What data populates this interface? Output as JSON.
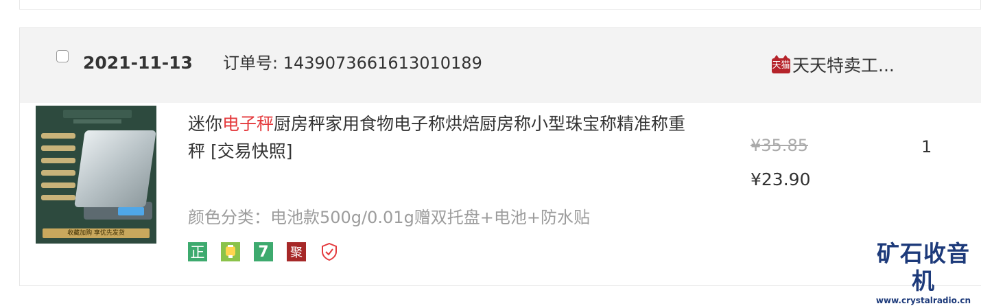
{
  "order": {
    "date": "2021-11-13",
    "order_number_label": "订单号: 1439073661613010189",
    "shop": {
      "icon_name": "tmall-icon",
      "icon_text": "天猫",
      "name": "天天特卖工..."
    }
  },
  "item": {
    "title_prefix": "迷你",
    "title_highlight": "电子秤",
    "title_suffix": "厨房秤家用食物电子称烘焙厨房称小型珠宝称精准称重秤 [交易快照]",
    "sku": "颜色分类：电池款500g/0.01g赠双托盘+电池+防水贴",
    "badges": [
      {
        "icon": "zheng-badge-icon",
        "text": "正"
      },
      {
        "icon": "baoxian-badge-icon",
        "text": ""
      },
      {
        "icon": "seven-day-return-badge-icon",
        "text": "7"
      },
      {
        "icon": "ju-badge-icon",
        "text": "聚"
      },
      {
        "icon": "shield-check-icon",
        "text": ""
      }
    ],
    "image_footer_text": "收藏加购 享优先发货",
    "original_price": "¥35.85",
    "price": "¥23.90",
    "quantity": "1"
  },
  "watermark": {
    "title": "矿石收音机",
    "url": "www.crystalradio.cn"
  },
  "colors": {
    "highlight": "#e4393c",
    "header_bg": "#f3f3f3",
    "tmall_red": "#b5232a",
    "watermark_blue": "#1d3a7a"
  }
}
